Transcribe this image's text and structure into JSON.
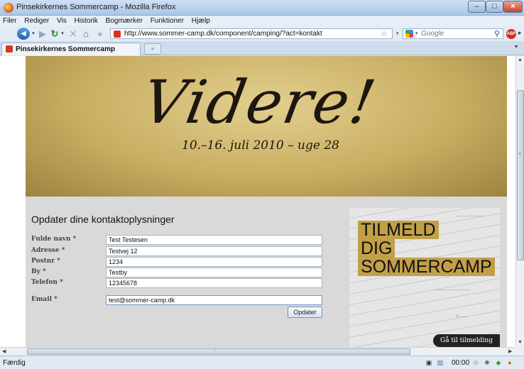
{
  "window": {
    "title": "Pinsekirkernes Sommercamp - Mozilla Firefox"
  },
  "menu": [
    "Filer",
    "Rediger",
    "Vis",
    "Historik",
    "Bogmærker",
    "Funktioner",
    "Hjælp"
  ],
  "nav": {
    "url": "http://www.sommer-camp.dk/component/camping/?act=kontakt",
    "search_placeholder": "Google"
  },
  "tabs": {
    "active_label": "Pinsekirkernes Sommercamp",
    "new_tab": "+"
  },
  "banner": {
    "slogan": "Videre!",
    "dates": "10.–16. juli 2010 – uge 28"
  },
  "form": {
    "heading": "Opdater dine kontaktoplysninger",
    "fields": [
      {
        "label": "Fulde navn *",
        "value": "Test Testesen"
      },
      {
        "label": "Adresse *",
        "value": "Testvej 12"
      },
      {
        "label": "Postnr *",
        "value": "1234"
      },
      {
        "label": "By *",
        "value": "Testby"
      },
      {
        "label": "Telefon *",
        "value": "12345678"
      },
      {
        "label": "Email *",
        "value": "test@sommer-camp.dk"
      }
    ],
    "submit": "Opdater"
  },
  "promo": {
    "lines": [
      "TILMELD",
      "DIG",
      "SOMMERCAMP"
    ],
    "cta": "Gå til tilmelding"
  },
  "status": {
    "text": "Færdig",
    "time": "00:00"
  },
  "colors": {
    "banner_gold": "#c9ae62",
    "promo_gold": "#c2a048",
    "content_gray": "#d9d9d9"
  }
}
